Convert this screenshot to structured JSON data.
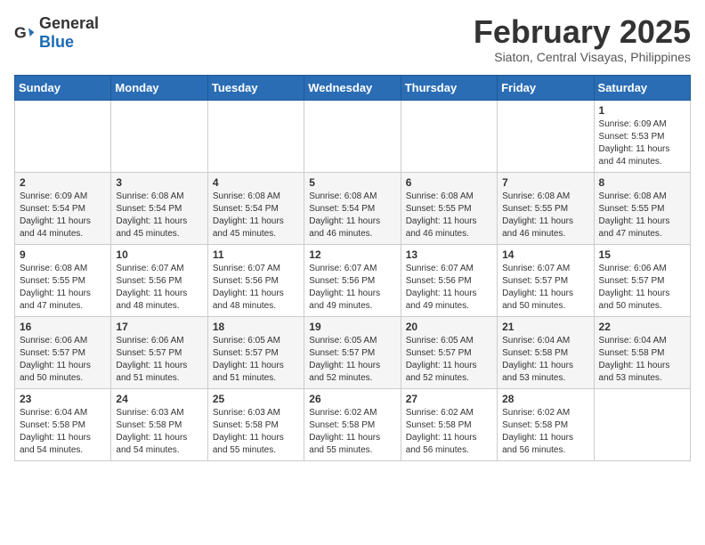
{
  "header": {
    "logo_general": "General",
    "logo_blue": "Blue",
    "month_year": "February 2025",
    "location": "Siaton, Central Visayas, Philippines"
  },
  "weekdays": [
    "Sunday",
    "Monday",
    "Tuesday",
    "Wednesday",
    "Thursday",
    "Friday",
    "Saturday"
  ],
  "weeks": [
    [
      {
        "day": "",
        "info": ""
      },
      {
        "day": "",
        "info": ""
      },
      {
        "day": "",
        "info": ""
      },
      {
        "day": "",
        "info": ""
      },
      {
        "day": "",
        "info": ""
      },
      {
        "day": "",
        "info": ""
      },
      {
        "day": "1",
        "info": "Sunrise: 6:09 AM\nSunset: 5:53 PM\nDaylight: 11 hours and 44 minutes."
      }
    ],
    [
      {
        "day": "2",
        "info": "Sunrise: 6:09 AM\nSunset: 5:54 PM\nDaylight: 11 hours and 44 minutes."
      },
      {
        "day": "3",
        "info": "Sunrise: 6:08 AM\nSunset: 5:54 PM\nDaylight: 11 hours and 45 minutes."
      },
      {
        "day": "4",
        "info": "Sunrise: 6:08 AM\nSunset: 5:54 PM\nDaylight: 11 hours and 45 minutes."
      },
      {
        "day": "5",
        "info": "Sunrise: 6:08 AM\nSunset: 5:54 PM\nDaylight: 11 hours and 46 minutes."
      },
      {
        "day": "6",
        "info": "Sunrise: 6:08 AM\nSunset: 5:55 PM\nDaylight: 11 hours and 46 minutes."
      },
      {
        "day": "7",
        "info": "Sunrise: 6:08 AM\nSunset: 5:55 PM\nDaylight: 11 hours and 46 minutes."
      },
      {
        "day": "8",
        "info": "Sunrise: 6:08 AM\nSunset: 5:55 PM\nDaylight: 11 hours and 47 minutes."
      }
    ],
    [
      {
        "day": "9",
        "info": "Sunrise: 6:08 AM\nSunset: 5:55 PM\nDaylight: 11 hours and 47 minutes."
      },
      {
        "day": "10",
        "info": "Sunrise: 6:07 AM\nSunset: 5:56 PM\nDaylight: 11 hours and 48 minutes."
      },
      {
        "day": "11",
        "info": "Sunrise: 6:07 AM\nSunset: 5:56 PM\nDaylight: 11 hours and 48 minutes."
      },
      {
        "day": "12",
        "info": "Sunrise: 6:07 AM\nSunset: 5:56 PM\nDaylight: 11 hours and 49 minutes."
      },
      {
        "day": "13",
        "info": "Sunrise: 6:07 AM\nSunset: 5:56 PM\nDaylight: 11 hours and 49 minutes."
      },
      {
        "day": "14",
        "info": "Sunrise: 6:07 AM\nSunset: 5:57 PM\nDaylight: 11 hours and 50 minutes."
      },
      {
        "day": "15",
        "info": "Sunrise: 6:06 AM\nSunset: 5:57 PM\nDaylight: 11 hours and 50 minutes."
      }
    ],
    [
      {
        "day": "16",
        "info": "Sunrise: 6:06 AM\nSunset: 5:57 PM\nDaylight: 11 hours and 50 minutes."
      },
      {
        "day": "17",
        "info": "Sunrise: 6:06 AM\nSunset: 5:57 PM\nDaylight: 11 hours and 51 minutes."
      },
      {
        "day": "18",
        "info": "Sunrise: 6:05 AM\nSunset: 5:57 PM\nDaylight: 11 hours and 51 minutes."
      },
      {
        "day": "19",
        "info": "Sunrise: 6:05 AM\nSunset: 5:57 PM\nDaylight: 11 hours and 52 minutes."
      },
      {
        "day": "20",
        "info": "Sunrise: 6:05 AM\nSunset: 5:57 PM\nDaylight: 11 hours and 52 minutes."
      },
      {
        "day": "21",
        "info": "Sunrise: 6:04 AM\nSunset: 5:58 PM\nDaylight: 11 hours and 53 minutes."
      },
      {
        "day": "22",
        "info": "Sunrise: 6:04 AM\nSunset: 5:58 PM\nDaylight: 11 hours and 53 minutes."
      }
    ],
    [
      {
        "day": "23",
        "info": "Sunrise: 6:04 AM\nSunset: 5:58 PM\nDaylight: 11 hours and 54 minutes."
      },
      {
        "day": "24",
        "info": "Sunrise: 6:03 AM\nSunset: 5:58 PM\nDaylight: 11 hours and 54 minutes."
      },
      {
        "day": "25",
        "info": "Sunrise: 6:03 AM\nSunset: 5:58 PM\nDaylight: 11 hours and 55 minutes."
      },
      {
        "day": "26",
        "info": "Sunrise: 6:02 AM\nSunset: 5:58 PM\nDaylight: 11 hours and 55 minutes."
      },
      {
        "day": "27",
        "info": "Sunrise: 6:02 AM\nSunset: 5:58 PM\nDaylight: 11 hours and 56 minutes."
      },
      {
        "day": "28",
        "info": "Sunrise: 6:02 AM\nSunset: 5:58 PM\nDaylight: 11 hours and 56 minutes."
      },
      {
        "day": "",
        "info": ""
      }
    ]
  ]
}
